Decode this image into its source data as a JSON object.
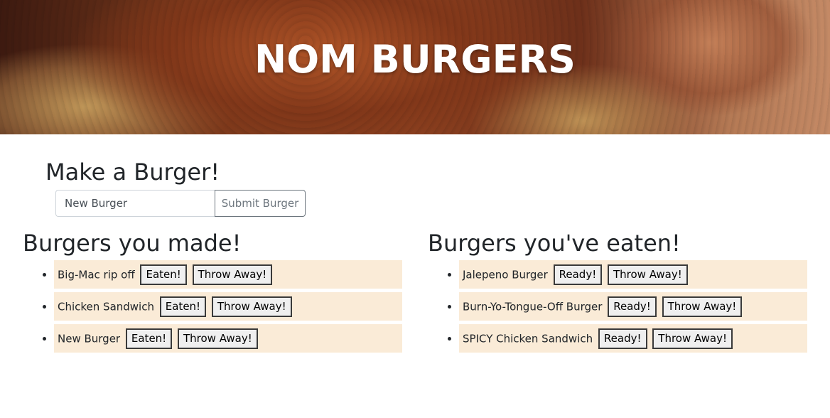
{
  "header": {
    "title": "NOM BURGERS"
  },
  "make": {
    "title": "Make a Burger!",
    "input_value": "New Burger",
    "submit_label": "Submit Burger"
  },
  "made": {
    "title": "Burgers you made!",
    "items": [
      {
        "name": "Big-Mac rip off",
        "primary_label": "Eaten!",
        "secondary_label": "Throw Away!"
      },
      {
        "name": "Chicken Sandwich",
        "primary_label": "Eaten!",
        "secondary_label": "Throw Away!"
      },
      {
        "name": "New Burger",
        "primary_label": "Eaten!",
        "secondary_label": "Throw Away!"
      }
    ]
  },
  "eaten": {
    "title": "Burgers you've eaten!",
    "items": [
      {
        "name": "Jalepeno Burger",
        "primary_label": "Ready!",
        "secondary_label": "Throw Away!"
      },
      {
        "name": "Burn-Yo-Tongue-Off Burger",
        "primary_label": "Ready!",
        "secondary_label": "Throw Away!"
      },
      {
        "name": "SPICY Chicken Sandwich",
        "primary_label": "Ready!",
        "secondary_label": "Throw Away!"
      }
    ]
  },
  "colors": {
    "list_item_bg": "#faebd7",
    "hero_text": "#ffffff"
  }
}
